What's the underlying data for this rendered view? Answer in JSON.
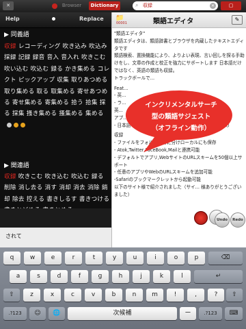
{
  "toolbar": {
    "close_glyph": "✕",
    "browser_label": "Browser",
    "dictionary_label": "Dictionary",
    "search_value": "収録",
    "search_clear_glyph": "✕",
    "done_glyph": "▢"
  },
  "left_toolbar": {
    "help_label": "Help",
    "replace_label": "Replace"
  },
  "synonyms": {
    "header": "▶ 同義語",
    "words": [
      "収録",
      "レコーディング",
      "吹き込み",
      "吹込み",
      "採録",
      "記録",
      "録音",
      "音入",
      "音入れ",
      "吹きこむ",
      "吹い込む",
      "吹込む",
      "録る",
      "かき集める",
      "コレクト",
      "ピックアップ",
      "収集",
      "取りあつめる",
      "取り集める",
      "取る",
      "取集める",
      "寄せあつめる",
      "寄せ集める",
      "寄集める",
      "拾う",
      "拾集",
      "採る",
      "採集",
      "掻き集める",
      "搔集める",
      "集める"
    ],
    "pager_colors": [
      "#cccccc",
      "#e7a21c",
      "#e7a21c"
    ]
  },
  "related": {
    "header": "▶ 関連語",
    "words": [
      "収録",
      "吹きこむ",
      "吹き込む",
      "吹込む",
      "録る",
      "削除",
      "消し去る",
      "消す",
      "消却",
      "消去",
      "消除",
      "銷却",
      "除去",
      "控える",
      "書きしるす",
      "書きつける",
      "書きとどめる",
      "書きとめる"
    ]
  },
  "suggestion": {
    "text": "されて"
  },
  "editor": {
    "folder_icon": "📁",
    "page_number": "00001",
    "title": "類語エディタ",
    "edit_glyph": "✎",
    "paragraphs": [
      "\"類語エディタ\"",
      "類語エディタは、類語辞書とブラウザを内蔵したテキストエディタです",
      "類語検索、置換機能により、よりよい表現、言い回しを探る手助けをし、文章の作成と校正を強力にサポートします 日本語だけではなく、英語の類語も収録。",
      "トラックボールで...",
      "Feat...",
      "- 英...",
      "- ラ...",
      "英...",
      "アプ...",
      "- 日本語で1万語以上の日本語のワード... 語以上の英語の",
      "収録",
      "- ファイルをフォルダごとに分けローカルにも保存",
      "- Atok,Twitter,FaceBook,Mailと連携可能",
      "- デフォルトでアプリ,WebサイトのURLスキームを50個以上サポート",
      "- 任意のアプリやWebのURLスキームを追加可能",
      "-Safariのブックマークレットから起動可能",
      "以下のサイト様で紹介されました（サイ... 様ありがとうございました）"
    ]
  },
  "callout": {
    "lines": [
      "インクリメンタルサーチ",
      "型の類語サジェスト",
      "（オフライン動作）"
    ],
    "color": "#e8302a"
  },
  "tools": {
    "undo_label": "Undo",
    "redo_label": "Redo"
  },
  "keyboard": {
    "row1": [
      "q",
      "w",
      "e",
      "r",
      "t",
      "y",
      "u",
      "i",
      "o",
      "p"
    ],
    "row2": [
      "a",
      "s",
      "d",
      "f",
      "g",
      "h",
      "j",
      "k",
      "l"
    ],
    "row3": [
      "z",
      "x",
      "c",
      "v",
      "b",
      "n",
      "m",
      "!",
      ","
    ],
    "convert_label": "次候補",
    "numbers_label": ".?123",
    "backspace_glyph": "⌫",
    "enter_glyph": "↵",
    "shift_glyph": "⇧",
    "emoji_glyph": "☺",
    "hide_glyph": "⌨",
    "globe_glyph": "🌐",
    "dash_label": "ー",
    "question_label": "?"
  }
}
